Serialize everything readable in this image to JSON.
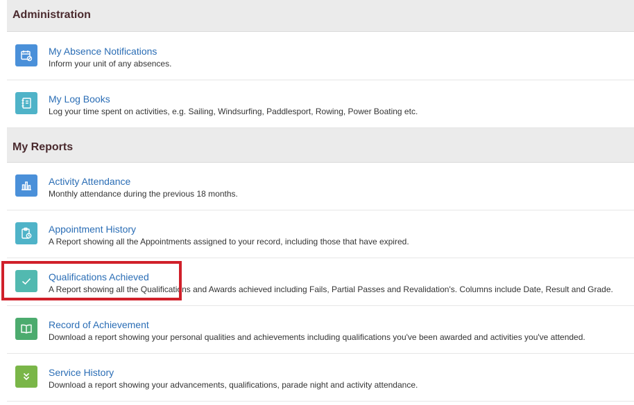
{
  "sections": [
    {
      "title": "Administration",
      "items": [
        {
          "title": "My Absence Notifications",
          "description": "Inform your unit of any absences.",
          "icon": "calendar-cancel-icon",
          "color": "#4a90d9"
        },
        {
          "title": "My Log Books",
          "description": "Log your time spent on activities, e.g. Sailing, Windsurfing, Paddlesport, Rowing, Power Boating etc.",
          "icon": "logbook-icon",
          "color": "#4fb3c8"
        }
      ]
    },
    {
      "title": "My Reports",
      "items": [
        {
          "title": "Activity Attendance",
          "description": "Monthly attendance during the previous 18 months.",
          "icon": "bar-chart-icon",
          "color": "#4a90d9"
        },
        {
          "title": "Appointment History",
          "description": "A Report showing all the Appointments assigned to your record, including those that have expired.",
          "icon": "clipboard-clock-icon",
          "color": "#4fb3c8"
        },
        {
          "title": "Qualifications Achieved",
          "description": "A Report showing all the Qualifications and Awards achieved including Fails, Partial Passes and Revalidation's. Columns include Date, Result and Grade.",
          "icon": "checkmark-icon",
          "color": "#52b9b0"
        },
        {
          "title": "Record of Achievement",
          "description": "Download a report showing your personal qualities and achievements including qualifications you've been awarded and activities you've attended.",
          "icon": "open-book-icon",
          "color": "#4cab6e"
        },
        {
          "title": "Service History",
          "description": "Download a report showing your advancements, qualifications, parade night and activity attendance.",
          "icon": "double-chevron-down-icon",
          "color": "#7ab648"
        }
      ]
    }
  ],
  "highlight": {
    "target": "Qualifications Achieved",
    "color": "#d0202a"
  }
}
